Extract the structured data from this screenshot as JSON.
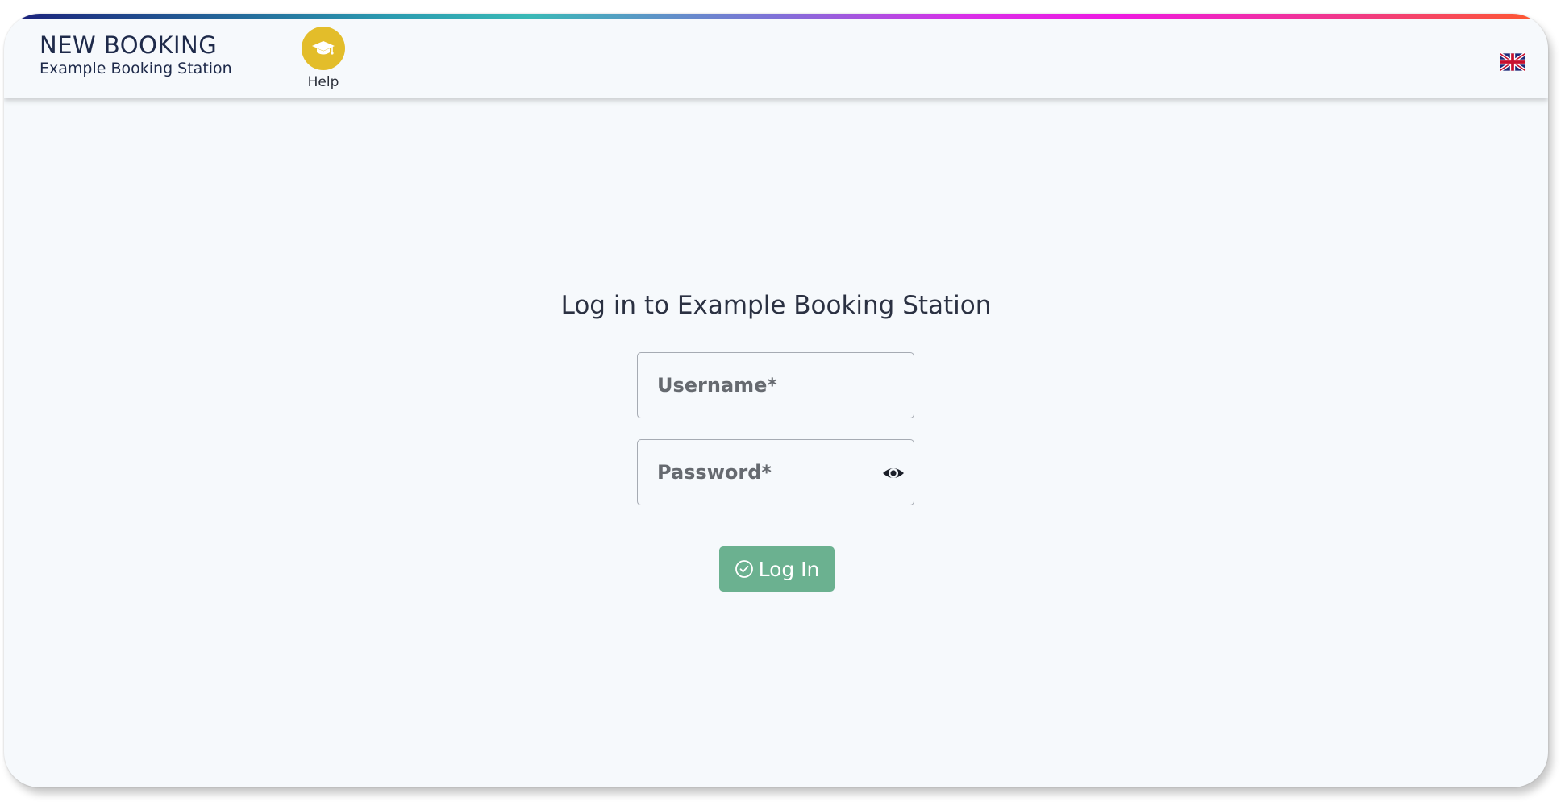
{
  "header": {
    "title": "NEW BOOKING",
    "subtitle": "Example Booking Station",
    "help_label": "Help",
    "help_icon": "graduation-cap-icon",
    "help_color": "#e3bd2a",
    "language_icon": "uk-flag-icon"
  },
  "login": {
    "heading": "Log in to Example Booking Station",
    "username_placeholder": "Username*",
    "username_value": "",
    "password_placeholder": "Password*",
    "password_value": "",
    "password_toggle_icon": "eye-icon",
    "submit_label": "Log In",
    "submit_icon": "check-circle-icon",
    "submit_color": "#6bb190"
  }
}
